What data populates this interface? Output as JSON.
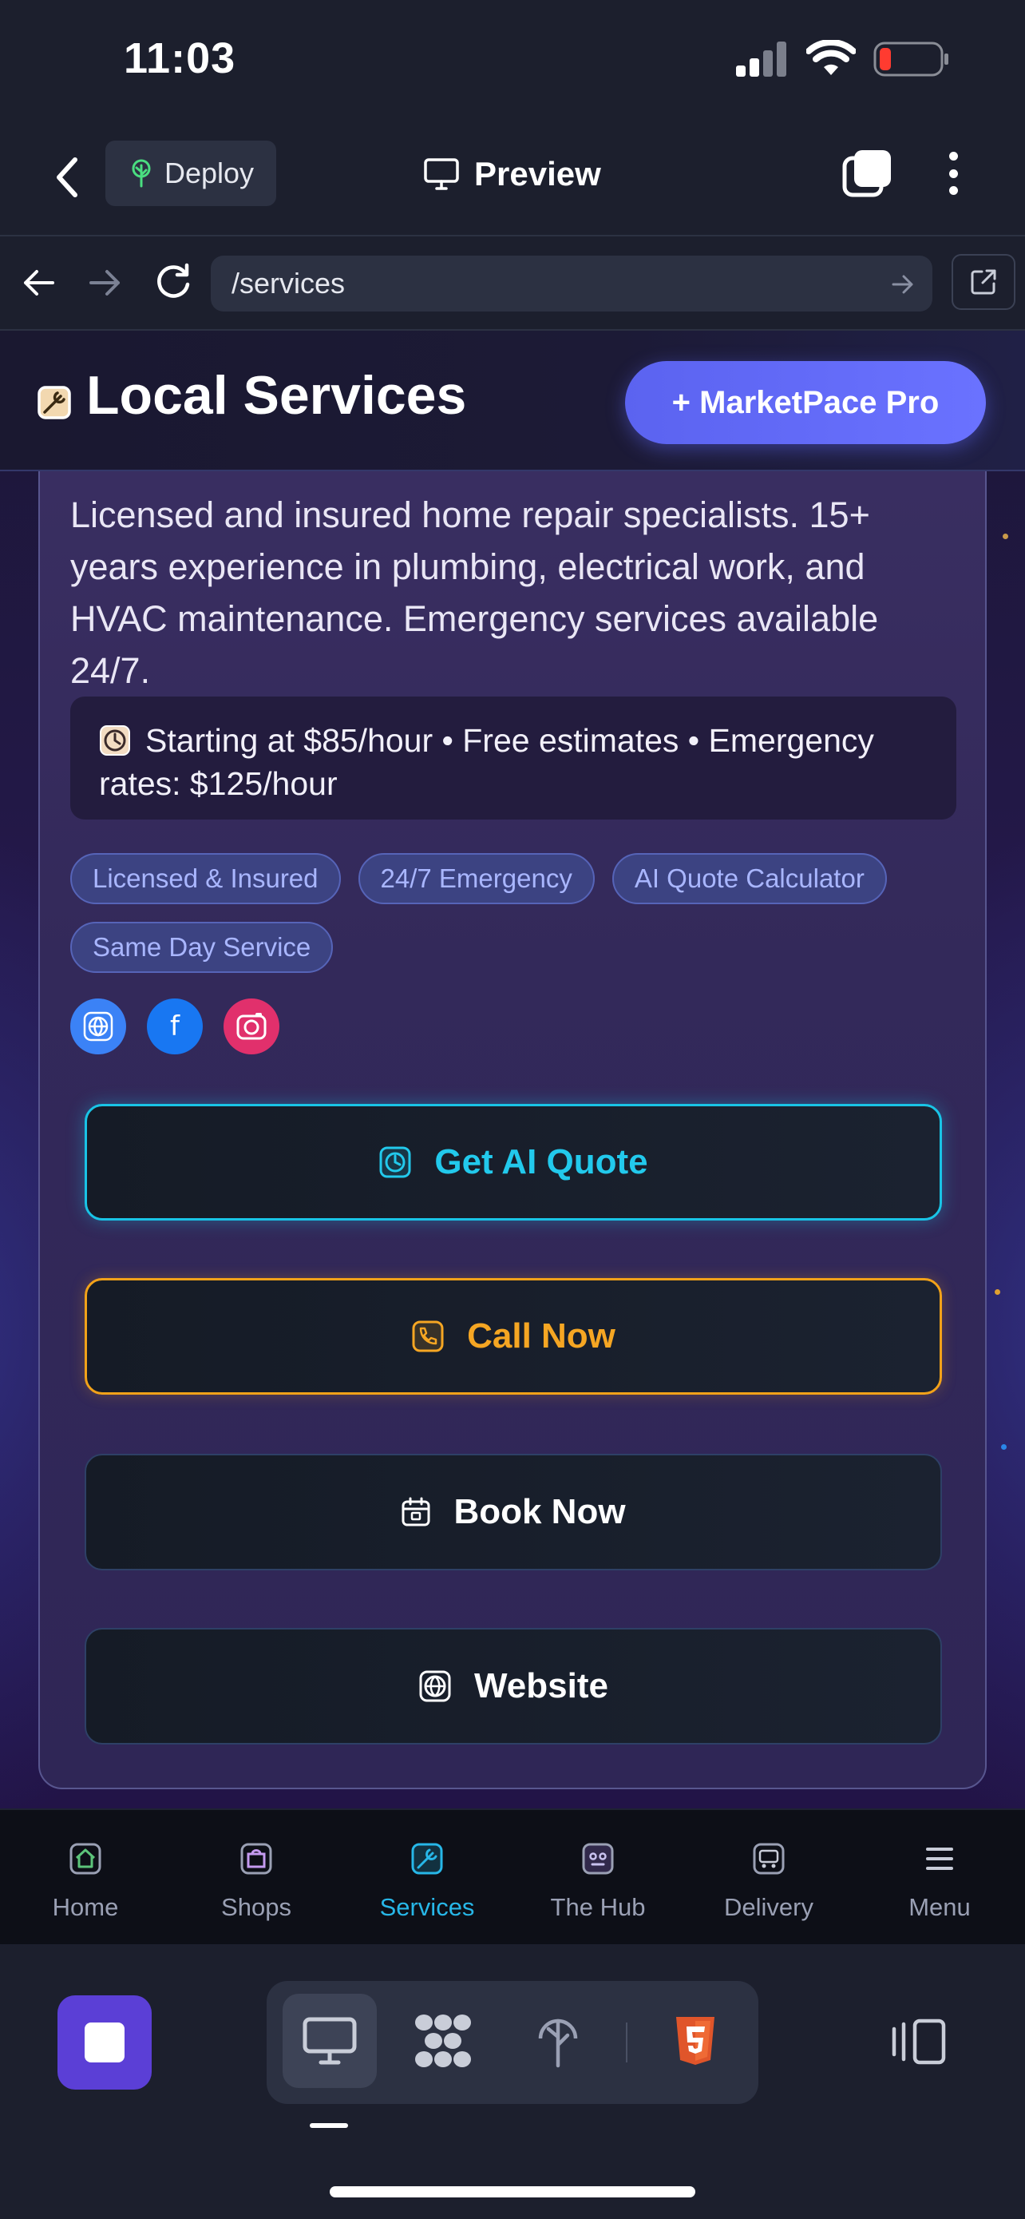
{
  "status_bar": {
    "time": "11:03"
  },
  "app_bar": {
    "deploy_label": "Deploy",
    "preview_label": "Preview"
  },
  "browser": {
    "url": "/services"
  },
  "site_header": {
    "title": "Local Services",
    "pro_button": "+ MarketPace Pro"
  },
  "service_card": {
    "description": "Licensed and insured home repair specialists. 15+ years experience in plumbing, electrical work, and HVAC maintenance. Emergency services available 24/7.",
    "pricing": "Starting at $85/hour • Free estimates • Emergency rates: $125/hour",
    "tags": [
      "Licensed & Insured",
      "24/7 Emergency",
      "AI Quote Calculator",
      "Same Day Service"
    ],
    "social_facebook_glyph": "f",
    "actions": {
      "ai_quote": "Get AI Quote",
      "call": "Call Now",
      "book": "Book Now",
      "website": "Website"
    }
  },
  "site_nav": {
    "items": [
      {
        "label": "Home",
        "icon": "store-icon"
      },
      {
        "label": "Shops",
        "icon": "shopping-bag-icon"
      },
      {
        "label": "Services",
        "icon": "wrench-icon",
        "active": true
      },
      {
        "label": "The Hub",
        "icon": "robot-face-icon"
      },
      {
        "label": "Delivery",
        "icon": "bus-icon"
      },
      {
        "label": "Menu",
        "icon": "hamburger-icon"
      }
    ]
  },
  "colors": {
    "accent_cyan": "#22c9ec",
    "accent_orange": "#f5a623",
    "pro_button": "#5b63f0",
    "stop_button": "#5b3fd6"
  }
}
